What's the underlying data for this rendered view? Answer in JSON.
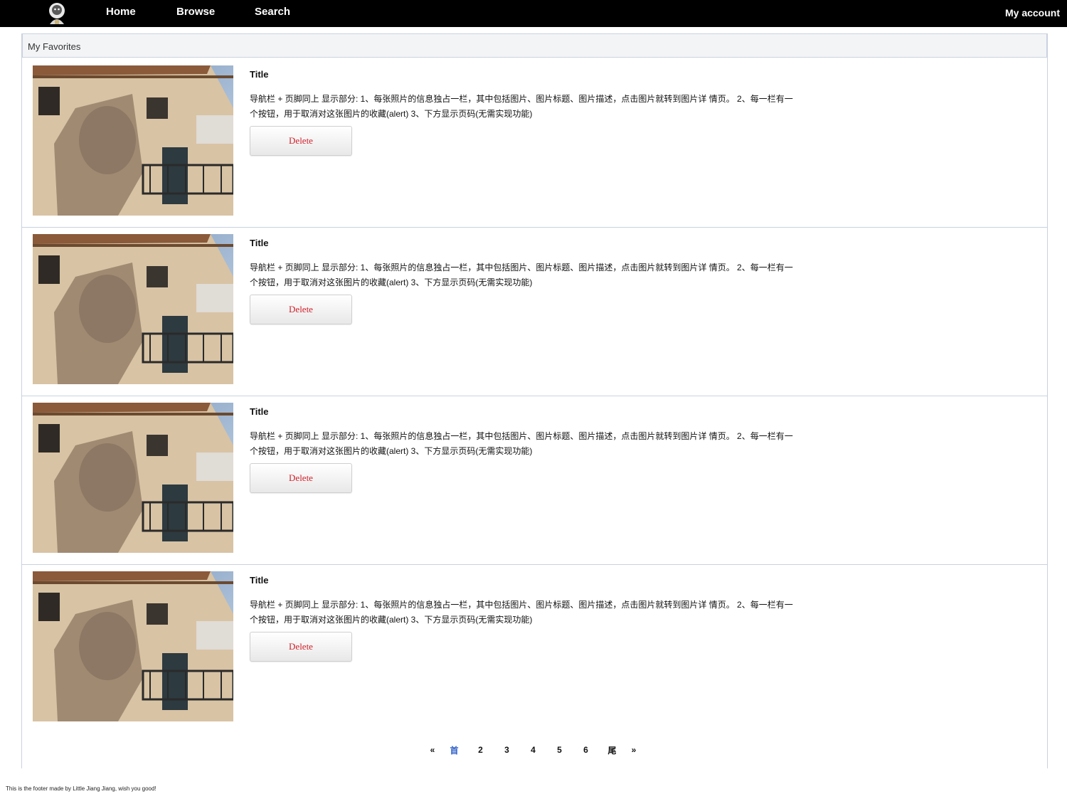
{
  "navbar": {
    "home": "Home",
    "browse": "Browse",
    "search": "Search",
    "account": "My account"
  },
  "panel": {
    "title": "My Favorites"
  },
  "favorites": [
    {
      "title": "Title",
      "desc_line1": "导航栏 + 页脚同上 显示部分: 1、每张照片的信息独占一栏，其中包括图片、图片标题、图片描述，点击图片就转到图片详 情页。 2、每一栏有一",
      "desc_line2": "个按钮，用于取消对这张图片的收藏(alert) 3、下方显示页码(无需实现功能)",
      "delete_label": "Delete"
    },
    {
      "title": "Title",
      "desc_line1": "导航栏 + 页脚同上 显示部分: 1、每张照片的信息独占一栏，其中包括图片、图片标题、图片描述，点击图片就转到图片详 情页。 2、每一栏有一",
      "desc_line2": "个按钮，用于取消对这张图片的收藏(alert) 3、下方显示页码(无需实现功能)",
      "delete_label": "Delete"
    },
    {
      "title": "Title",
      "desc_line1": "导航栏 + 页脚同上 显示部分: 1、每张照片的信息独占一栏，其中包括图片、图片标题、图片描述，点击图片就转到图片详 情页。 2、每一栏有一",
      "desc_line2": "个按钮，用于取消对这张图片的收藏(alert) 3、下方显示页码(无需实现功能)",
      "delete_label": "Delete"
    },
    {
      "title": "Title",
      "desc_line1": "导航栏 + 页脚同上 显示部分: 1、每张照片的信息独占一栏，其中包括图片、图片标题、图片描述，点击图片就转到图片详 情页。 2、每一栏有一",
      "desc_line2": "个按钮，用于取消对这张图片的收藏(alert) 3、下方显示页码(无需实现功能)",
      "delete_label": "Delete"
    }
  ],
  "pagination": {
    "prev": "«",
    "first": "首",
    "pages": [
      "2",
      "3",
      "4",
      "5",
      "6"
    ],
    "last": "尾",
    "next": "»",
    "current": "首"
  },
  "footer": {
    "note": "This is the footer made by Little Jiang Jiang, wish you good!"
  },
  "colors": {
    "navbar_bg": "#000000",
    "delete_text": "#d0202a",
    "current_page": "#2e5fc7",
    "panel_border": "#c9d2e0"
  }
}
